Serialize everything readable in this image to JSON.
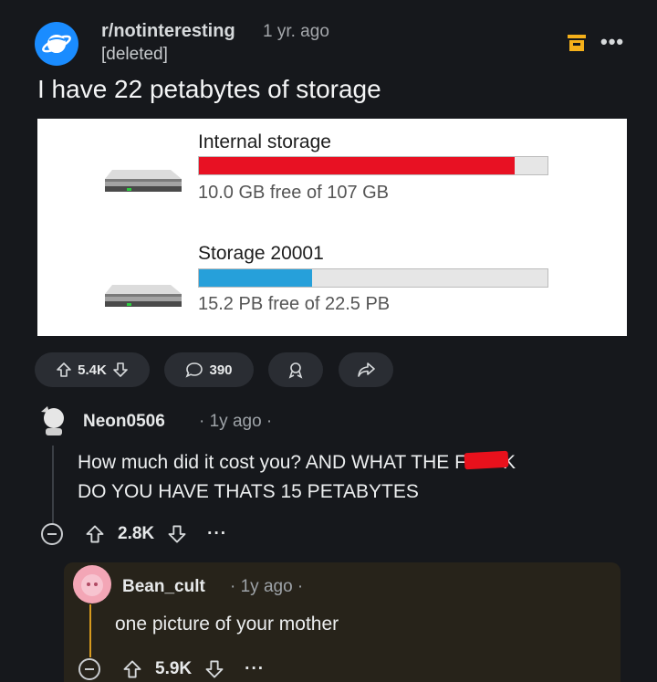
{
  "post": {
    "subreddit": "r/notinteresting",
    "time": "1 yr. ago",
    "author": "[deleted]",
    "title": "I have 22 petabytes of storage",
    "upvotes": "5.4K",
    "comments": "390"
  },
  "image": {
    "drives": [
      {
        "name": "Internal storage",
        "free_text": "10.0 GB free of 107 GB",
        "used_fraction": 0.906,
        "bar_color": "#e81123"
      },
      {
        "name": "Storage 20001",
        "free_text": "15.2 PB free of 22.5 PB",
        "used_fraction": 0.324,
        "bar_color": "#26a0da"
      }
    ]
  },
  "comments": [
    {
      "user": "Neon0506",
      "meta": "· 1y ago ·",
      "line1_a": "How much did it cost you? AND WHAT THE F",
      "line1_b": "K",
      "line2": "DO YOU HAVE THATS 15 PETABYTES",
      "votes": "2.8K",
      "more": "···"
    },
    {
      "user": "Bean_cult",
      "meta": "· 1y ago ·",
      "body": "one picture of your mother",
      "votes": "5.9K",
      "more": "···"
    }
  ],
  "icons": {
    "subreddit": "planet-icon",
    "save": "bookmark-icon",
    "more": "more-dots-icon",
    "upvote": "arrow-up-icon",
    "downvote": "arrow-down-icon",
    "comment": "speech-bubble-icon",
    "award": "award-icon",
    "share": "share-icon"
  },
  "colors": {
    "background": "#16181c",
    "accent": "#1a8cff",
    "redaction": "#e8111c"
  }
}
